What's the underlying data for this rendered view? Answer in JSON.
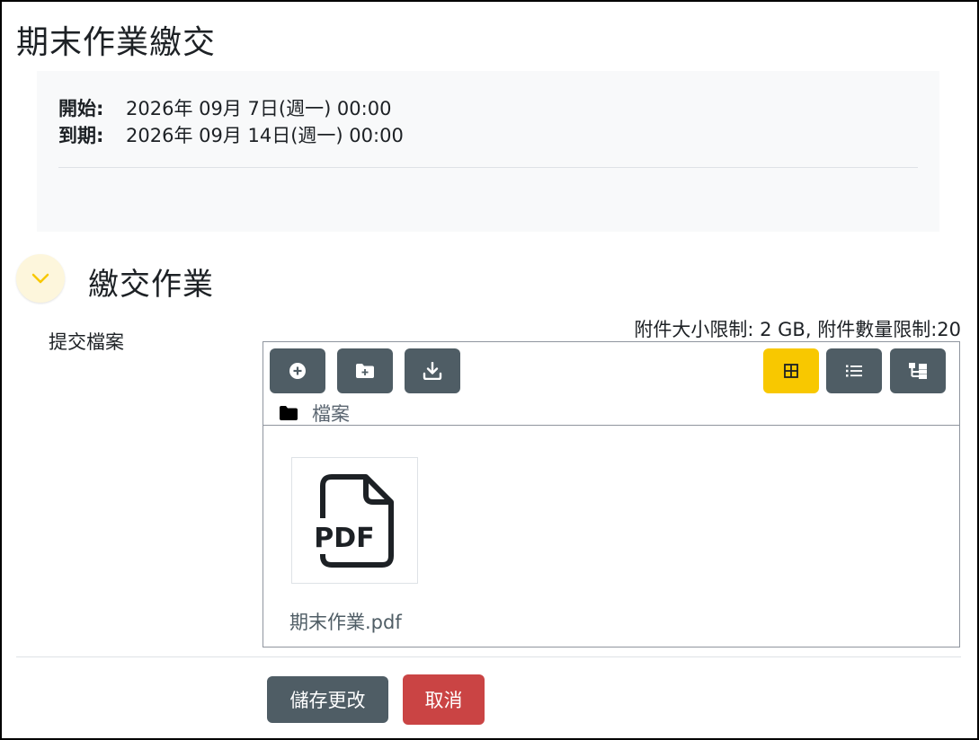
{
  "page": {
    "title": "期末作業繳交"
  },
  "dates": {
    "start_label": "開始:",
    "start_value": "2026年 09月 7日(週一) 00:00",
    "due_label": "到期:",
    "due_value": "2026年 09月 14日(週一) 00:00"
  },
  "section": {
    "title": "繳交作業",
    "toggle_icon": "chevron-down-icon"
  },
  "field": {
    "label": "提交檔案",
    "limits": "附件大小限制: 2 GB, 附件數量限制:20"
  },
  "filemanager": {
    "toolbar": {
      "add_icon": "plus-circle-icon",
      "new_folder_icon": "folder-plus-icon",
      "download_icon": "download-icon",
      "view_icons_icon": "grid-icon",
      "view_list_icon": "list-icon",
      "view_tree_icon": "tree-icon"
    },
    "path_label": "檔案",
    "files": [
      {
        "name": "期末作業.pdf",
        "icon": "pdf-file-icon",
        "icon_text": "PDF"
      }
    ]
  },
  "actions": {
    "save_label": "儲存更改",
    "cancel_label": "取消"
  },
  "colors": {
    "primary": "#4f5d65",
    "accent": "#f8c800",
    "danger": "#ca4444"
  }
}
